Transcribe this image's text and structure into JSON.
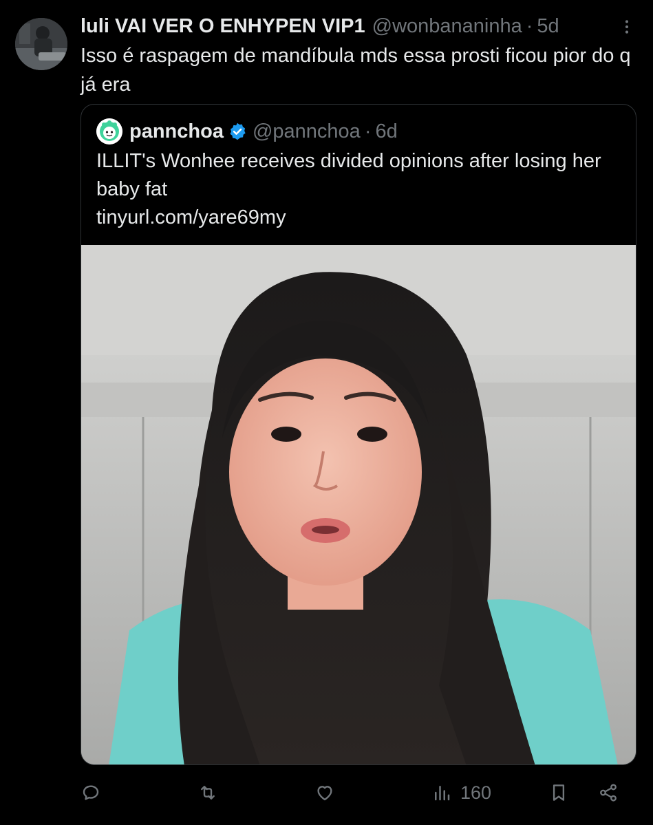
{
  "tweet": {
    "display_name": "luli VAI VER O ENHYPEN VIP1",
    "handle": "@wonbananinha",
    "separator": "·",
    "time": "5d",
    "text": "Isso é raspagem de mandíbula mds essa prosti ficou pior do q já era",
    "avatar_icon": "user-avatar-photo"
  },
  "quote": {
    "display_name": "pannchoa",
    "handle": "@pannchoa",
    "separator": "·",
    "time": "6d",
    "verified": true,
    "text": "ILLIT's Wonhee receives divided opinions after losing her baby fat",
    "link": "tinyurl.com/yare69my",
    "avatar_icon": "pannchoa-logo",
    "media_icon": "video-thumbnail-photo"
  },
  "actions": {
    "reply_icon": "reply-icon",
    "retweet_icon": "retweet-icon",
    "like_icon": "like-icon",
    "views_icon": "views-icon",
    "views_count": "160",
    "bookmark_icon": "bookmark-icon",
    "share_icon": "share-icon"
  },
  "colors": {
    "background": "#000000",
    "text_primary": "#e7e9ea",
    "text_secondary": "#71767b",
    "border": "#2f3336",
    "verified": "#1d9bf0"
  }
}
